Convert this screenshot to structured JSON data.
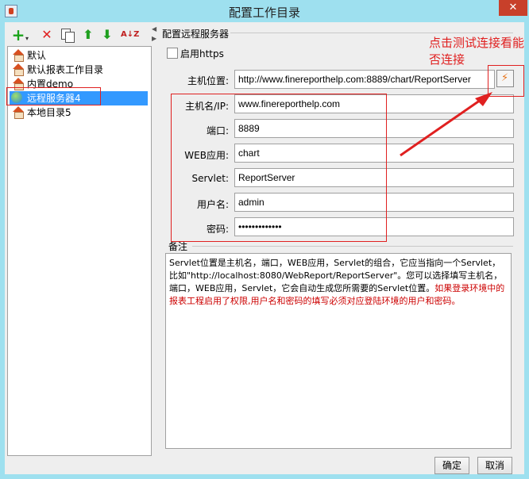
{
  "window": {
    "title": "配置工作目录",
    "close_glyph": "✕"
  },
  "toolbar": {
    "icons": [
      "add-icon",
      "delete-icon",
      "copy-icon",
      "move-up-icon",
      "move-down-icon",
      "sort-icon"
    ],
    "add_glyph": "+",
    "dropdown_glyph": "▾",
    "delete_glyph": "✕",
    "up_glyph": "⬆",
    "down_glyph": "⬇",
    "sort_glyph": "A↓Z"
  },
  "tree": {
    "items": [
      {
        "label": "默认",
        "icon": "house-icon",
        "selected": false
      },
      {
        "label": "默认报表工作目录",
        "icon": "house-icon",
        "selected": false
      },
      {
        "label": "内置demo",
        "icon": "house-icon",
        "selected": false
      },
      {
        "label": "远程服务器4",
        "icon": "globe-icon",
        "selected": true
      },
      {
        "label": "本地目录5",
        "icon": "house-icon",
        "selected": false
      }
    ]
  },
  "config": {
    "group_title": "配置远程服务器",
    "https_label": "启用https",
    "https_checked": false,
    "host_label": "主机位置:",
    "host_value": "http://www.finereporthelp.com:8889/chart/ReportServer",
    "hostname_label": "主机名/IP:",
    "hostname_value": "www.finereporthelp.com",
    "port_label": "端口:",
    "port_value": "8889",
    "webapp_label": "WEB应用:",
    "webapp_value": "chart",
    "servlet_label": "Servlet:",
    "servlet_value": "ReportServer",
    "username_label": "用户名:",
    "username_value": "admin",
    "password_label": "密码:",
    "password_value": "•••••••••••••"
  },
  "notes": {
    "title": "备注",
    "text_black": "Servlet位置是主机名，端口，WEB应用，Servlet的组合，它应当指向一个Servlet，比如\"http://localhost:8080/WebReport/ReportServer\"。您可以选择填写主机名，端口，WEB应用，Servlet，它会自动生成您所需要的Servlet位置。",
    "text_red": "如果登录环境中的报表工程启用了权限,用户名和密码的填写必须对应登陆环境的用户和密码。"
  },
  "annotation": {
    "text": "点击测试连接看能否连接",
    "color": "#e02020"
  },
  "footer": {
    "ok_label": "确定",
    "cancel_label": "取消"
  },
  "colors": {
    "selection": "#3399ff",
    "title_bar": "#9ee0ef",
    "annotation_red": "#e02020"
  }
}
